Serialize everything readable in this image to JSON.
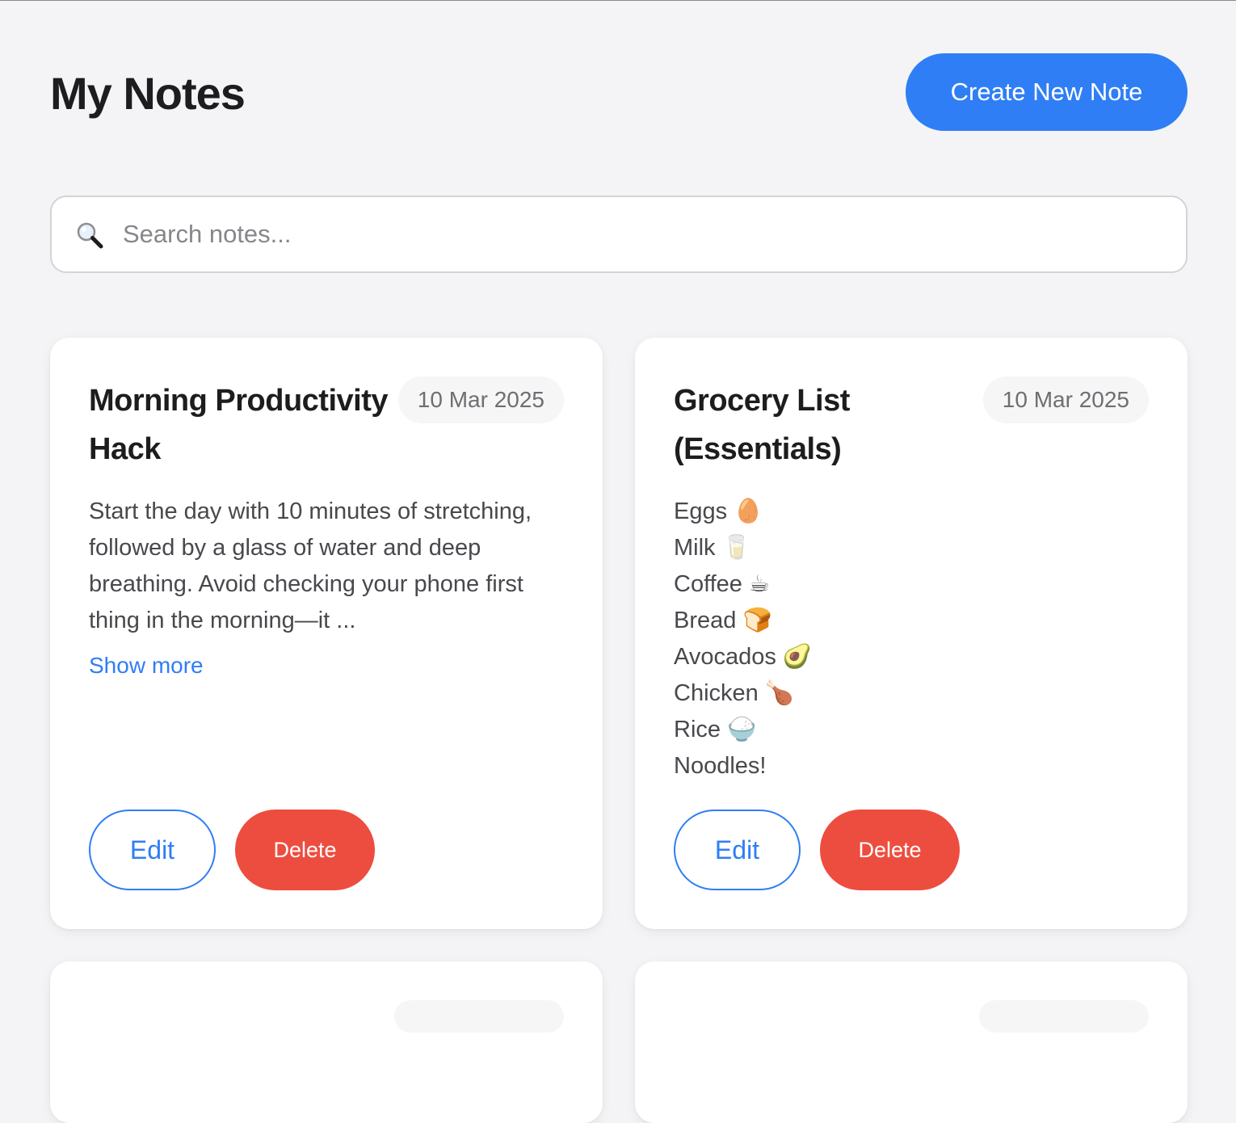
{
  "header": {
    "title": "My Notes",
    "create_label": "Create New Note"
  },
  "search": {
    "placeholder": "Search notes...",
    "value": ""
  },
  "notes": [
    {
      "title": "Morning Productivity Hack",
      "date": "10 Mar 2025",
      "body": "Start the day with 10 minutes of stretching, followed by a glass of water and deep breathing. Avoid checking your phone first thing in the morning—it ...",
      "show_more_label": "Show more",
      "edit_label": "Edit",
      "delete_label": "Delete"
    },
    {
      "title": "Grocery List (Essentials)",
      "date": "10 Mar 2025",
      "items": [
        "Eggs 🥚",
        "Milk 🥛",
        "Coffee ☕",
        "Bread 🍞",
        "Avocados 🥑",
        "Chicken 🍗",
        "Rice 🍚",
        "Noodles!"
      ],
      "edit_label": "Edit",
      "delete_label": "Delete"
    }
  ],
  "colors": {
    "accent": "#2f7ef5",
    "danger": "#ed4d3f",
    "background": "#f4f4f6"
  }
}
